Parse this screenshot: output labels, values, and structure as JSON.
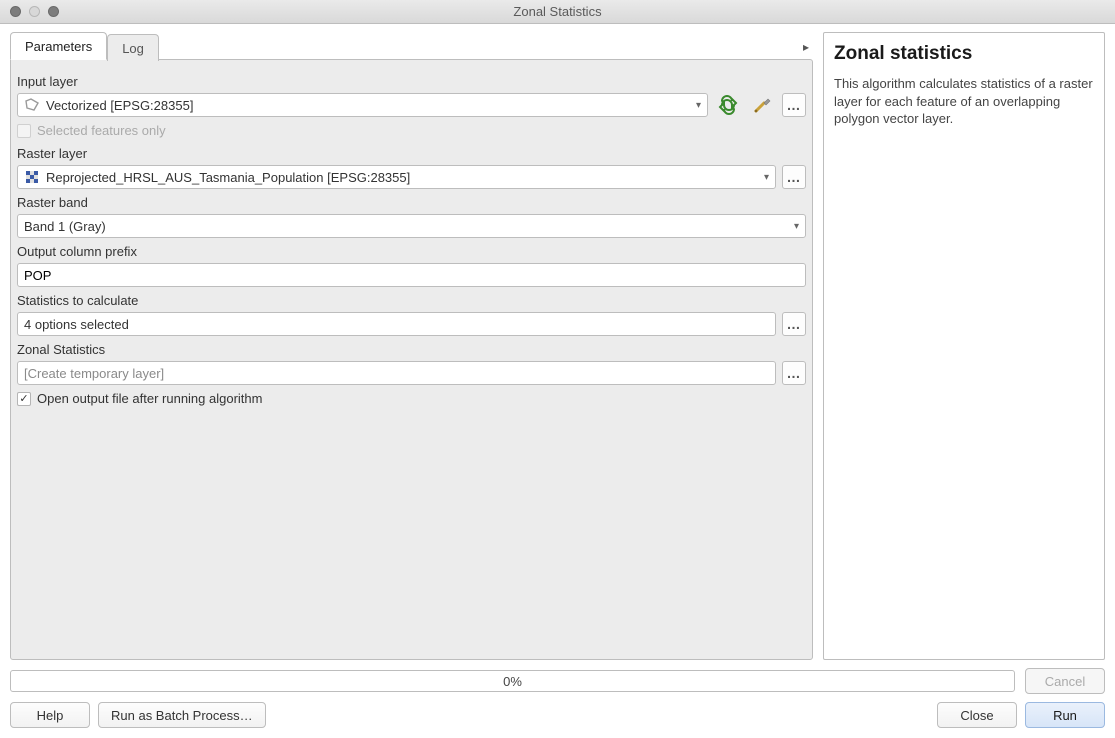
{
  "window": {
    "title": "Zonal Statistics"
  },
  "tabs": {
    "parameters": "Parameters",
    "log": "Log",
    "active": "parameters"
  },
  "fields": {
    "input_layer": {
      "label": "Input layer",
      "value": "Vectorized [EPSG:28355]"
    },
    "selected_only": {
      "label": "Selected features only",
      "checked": false,
      "enabled": false
    },
    "raster_layer": {
      "label": "Raster layer",
      "value": "Reprojected_HRSL_AUS_Tasmania_Population [EPSG:28355]"
    },
    "raster_band": {
      "label": "Raster band",
      "value": "Band 1 (Gray)"
    },
    "output_prefix": {
      "label": "Output column prefix",
      "value": "POP"
    },
    "stats_to_calc": {
      "label": "Statistics to calculate",
      "value": "4 options selected"
    },
    "zonal_stats_out": {
      "label": "Zonal Statistics",
      "placeholder": "[Create temporary layer]"
    },
    "open_output": {
      "label": "Open output file after running algorithm",
      "checked": true
    }
  },
  "help": {
    "title": "Zonal statistics",
    "body": "This algorithm calculates statistics of a raster layer for each feature of an overlapping polygon vector layer."
  },
  "progress": {
    "text": "0%"
  },
  "buttons": {
    "cancel": "Cancel",
    "help": "Help",
    "batch": "Run as Batch Process…",
    "close": "Close",
    "run": "Run",
    "browse": "…"
  }
}
